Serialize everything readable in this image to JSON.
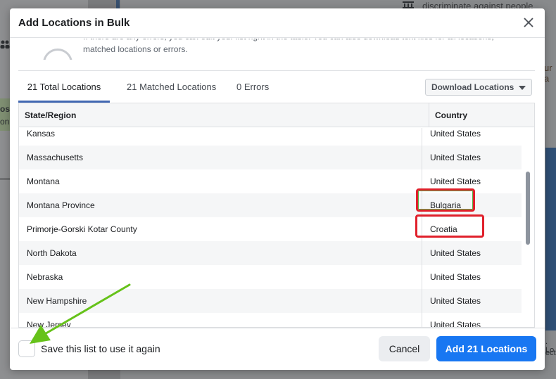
{
  "background": {
    "right_top_text": "discriminate against people based o",
    "right_mid_text": "ur a",
    "right_bottom_text_1": ". Lo",
    "right_bottom_text_2": "ect",
    "left_text_1": "os",
    "left_text_2": "on"
  },
  "modal": {
    "title": "Add Locations in Bulk",
    "close_icon": "close-icon",
    "intro_text": "If there are any errors, you can edit your list right in the table. You can also download text files for all locations, matched locations or errors."
  },
  "tabs": [
    {
      "label": "21 Total Locations",
      "active": true
    },
    {
      "label": "21 Matched Locations",
      "active": false
    },
    {
      "label": "0 Errors",
      "active": false
    }
  ],
  "download_button": {
    "label": "Download Locations",
    "icon": "caret-down-icon"
  },
  "table": {
    "headers": {
      "state": "State/Region",
      "country": "Country"
    },
    "rows": [
      {
        "state": "Kansas",
        "country": "United States"
      },
      {
        "state": "Massachusetts",
        "country": "United States"
      },
      {
        "state": "Montana",
        "country": "United States"
      },
      {
        "state": "Montana Province",
        "country": "Bulgaria"
      },
      {
        "state": "Primorje-Gorski Kotar County",
        "country": "Croatia"
      },
      {
        "state": "North Dakota",
        "country": "United States"
      },
      {
        "state": "Nebraska",
        "country": "United States"
      },
      {
        "state": "New Hampshire",
        "country": "United States"
      },
      {
        "state": "New Jersey",
        "country": "United States"
      }
    ]
  },
  "footer": {
    "checkbox_label": "Save this list to use it again",
    "checkbox_checked": false,
    "cancel_label": "Cancel",
    "add_label": "Add 21 Locations"
  },
  "colors": {
    "primary": "#1877f2",
    "highlight_red": "#e0202b",
    "annotation_green": "#66c21a",
    "tab_underline": "#4267b2"
  }
}
